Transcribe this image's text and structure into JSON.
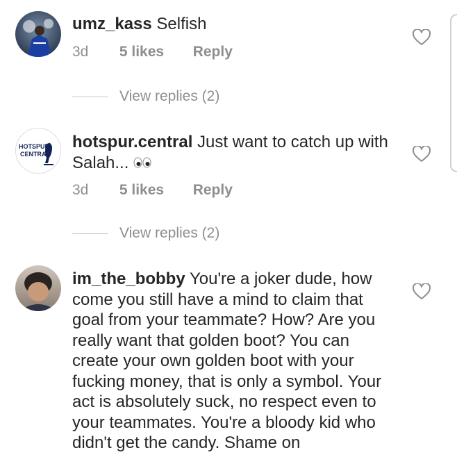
{
  "comments": [
    {
      "username": "umz_kass",
      "text": "Selfish",
      "time": "3d",
      "likes": "5 likes",
      "reply": "Reply",
      "view_replies": "View replies (2)"
    },
    {
      "username": "hotspur.central",
      "text": "Just want to catch up with Salah...",
      "emoji": "eyes",
      "avatar_label_line1": "HOTSPUR",
      "avatar_label_line2": "CENTRAL",
      "time": "3d",
      "likes": "5 likes",
      "reply": "Reply",
      "view_replies": "View replies (2)"
    },
    {
      "username": "im_the_bobby",
      "text": "You're a joker dude, how come you still have a mind to claim that goal from your teammate? How? Are you really want that golden boot? You can create your own golden boot with your fucking money, that is only a symbol. Your act is absolutely suck, no respect even to your teammates. You're a bloody kid who didn't get the candy. Shame on"
    }
  ],
  "icons": {
    "like": "heart-outline-icon",
    "emoji": "eyes-emoji-icon"
  },
  "colors": {
    "text": "#262626",
    "secondary": "#8e8e8e",
    "divider": "#c7c7c7"
  }
}
